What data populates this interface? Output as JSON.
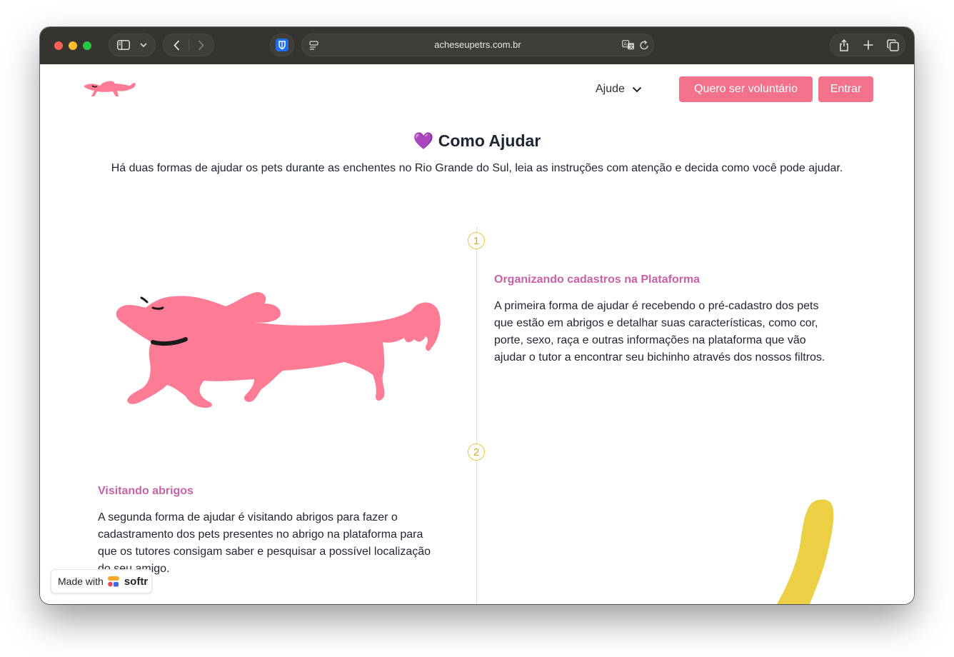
{
  "browser": {
    "url": "acheseupetrs.com.br"
  },
  "nav": {
    "help_label": "Ajude",
    "volunteer_button": "Quero ser voluntário",
    "login_button": "Entrar"
  },
  "page": {
    "heart_emoji": "💜",
    "title": "Como Ajudar",
    "subtitle": "Há duas formas de ajudar os pets durante as enchentes no Rio Grande do Sul, leia as instruções com atenção e decida como você pode ajudar."
  },
  "steps": [
    {
      "number": "1",
      "title": "Organizando cadastros na Plataforma",
      "lines": [
        "A primeira forma de ajudar é recebendo o pré-cadastro dos pets",
        "que estão em abrigos e detalhar suas características, como cor,",
        "porte, sexo, raça e outras informações na plataforma que vão",
        "ajudar o tutor a encontrar seu bichinho através dos nossos filtros."
      ]
    },
    {
      "number": "2",
      "title": "Visitando abrigos",
      "lines": [
        "A segunda forma de ajudar é visitando abrigos para fazer o",
        "cadastramento dos pets presentes no abrigo na plataforma para",
        "que os tutores consigam saber e pesquisar a possível localização",
        "do seu amigo."
      ]
    }
  ],
  "badge": {
    "made_with": "Made with",
    "brand": "softr"
  },
  "colors": {
    "accent_pink": "#f2728c",
    "dog_pink": "#fd7b94",
    "title_purple": "#c960a8",
    "step_yellow": "#e8c63f",
    "tail_yellow": "#eccf45"
  }
}
